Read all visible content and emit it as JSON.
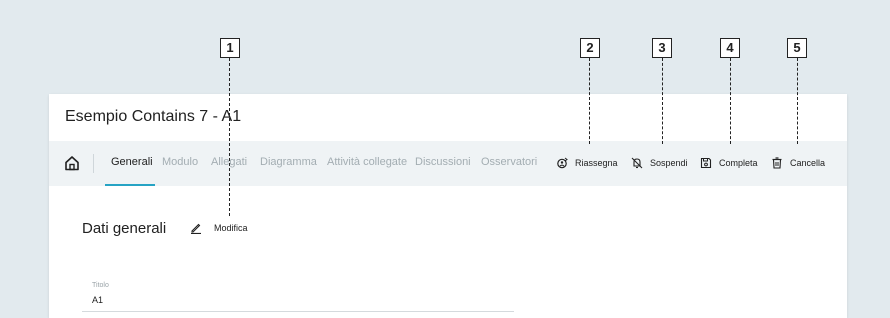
{
  "callouts": [
    "1",
    "2",
    "3",
    "4",
    "5"
  ],
  "page": {
    "title": "Esempio Contains 7 - A1"
  },
  "tabs": [
    {
      "label": "Generali",
      "active": true
    },
    {
      "label": "Modulo"
    },
    {
      "label": "Allegati"
    },
    {
      "label": "Diagramma"
    },
    {
      "label": "Attività collegate"
    },
    {
      "label": "Discussioni"
    },
    {
      "label": "Osservatori"
    }
  ],
  "actions": [
    {
      "label": "Riassegna",
      "icon": "reassign-icon"
    },
    {
      "label": "Sospendi",
      "icon": "suspend-icon"
    },
    {
      "label": "Completa",
      "icon": "save-icon"
    },
    {
      "label": "Cancella",
      "icon": "trash-icon"
    }
  ],
  "section": {
    "title": "Dati generali",
    "edit_label": "Modifica"
  },
  "field": {
    "label": "Titolo",
    "value": "A1"
  },
  "colors": {
    "background": "#e2eaee",
    "toolbar": "#eff3f5",
    "accent": "#26a3c4",
    "inactive_tab": "#a3adb2"
  }
}
